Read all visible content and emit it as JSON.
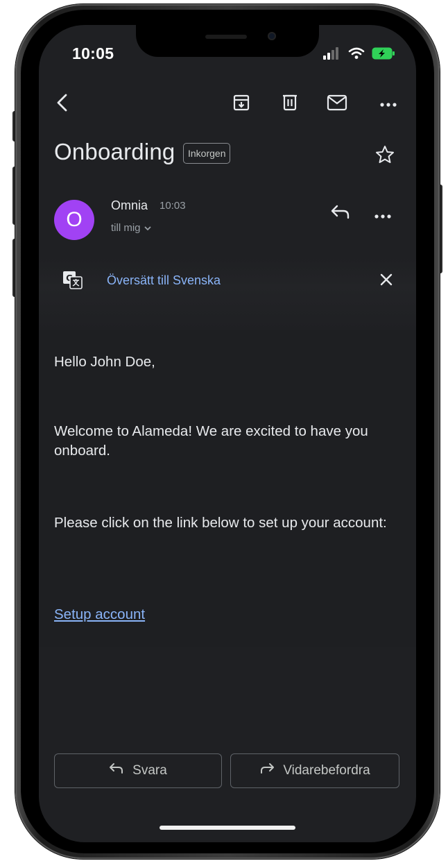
{
  "status_bar": {
    "time": "10:05",
    "icons": [
      "cellular-signal-icon",
      "wifi-icon",
      "battery-charging-icon"
    ]
  },
  "toolbar": {
    "back_icon": "chevron-left-icon",
    "actions": [
      "archive-icon",
      "trash-icon",
      "mail-icon",
      "more-horizontal-icon"
    ]
  },
  "email": {
    "subject": "Onboarding",
    "label": "Inkorgen",
    "star_icon": "star-outline-icon",
    "sender": {
      "avatar_initial": "O",
      "avatar_color": "#a142f4",
      "name": "Omnia",
      "time": "10:03",
      "recipient": "till mig"
    },
    "translate": {
      "link": "Översätt till Svenska"
    },
    "body": {
      "greeting": "Hello John Doe,",
      "welcome": "Welcome to Alameda! We are excited to have you onboard.",
      "instruction": "Please click on the link below to set up your account:",
      "link_text": "Setup account"
    }
  },
  "bottom_actions": {
    "reply_label": "Svara",
    "forward_label": "Vidarebefordra"
  },
  "colors": {
    "background": "#1f2023",
    "link": "#8ab4f8",
    "text": "#e8eaed",
    "muted": "#9aa0a6"
  }
}
